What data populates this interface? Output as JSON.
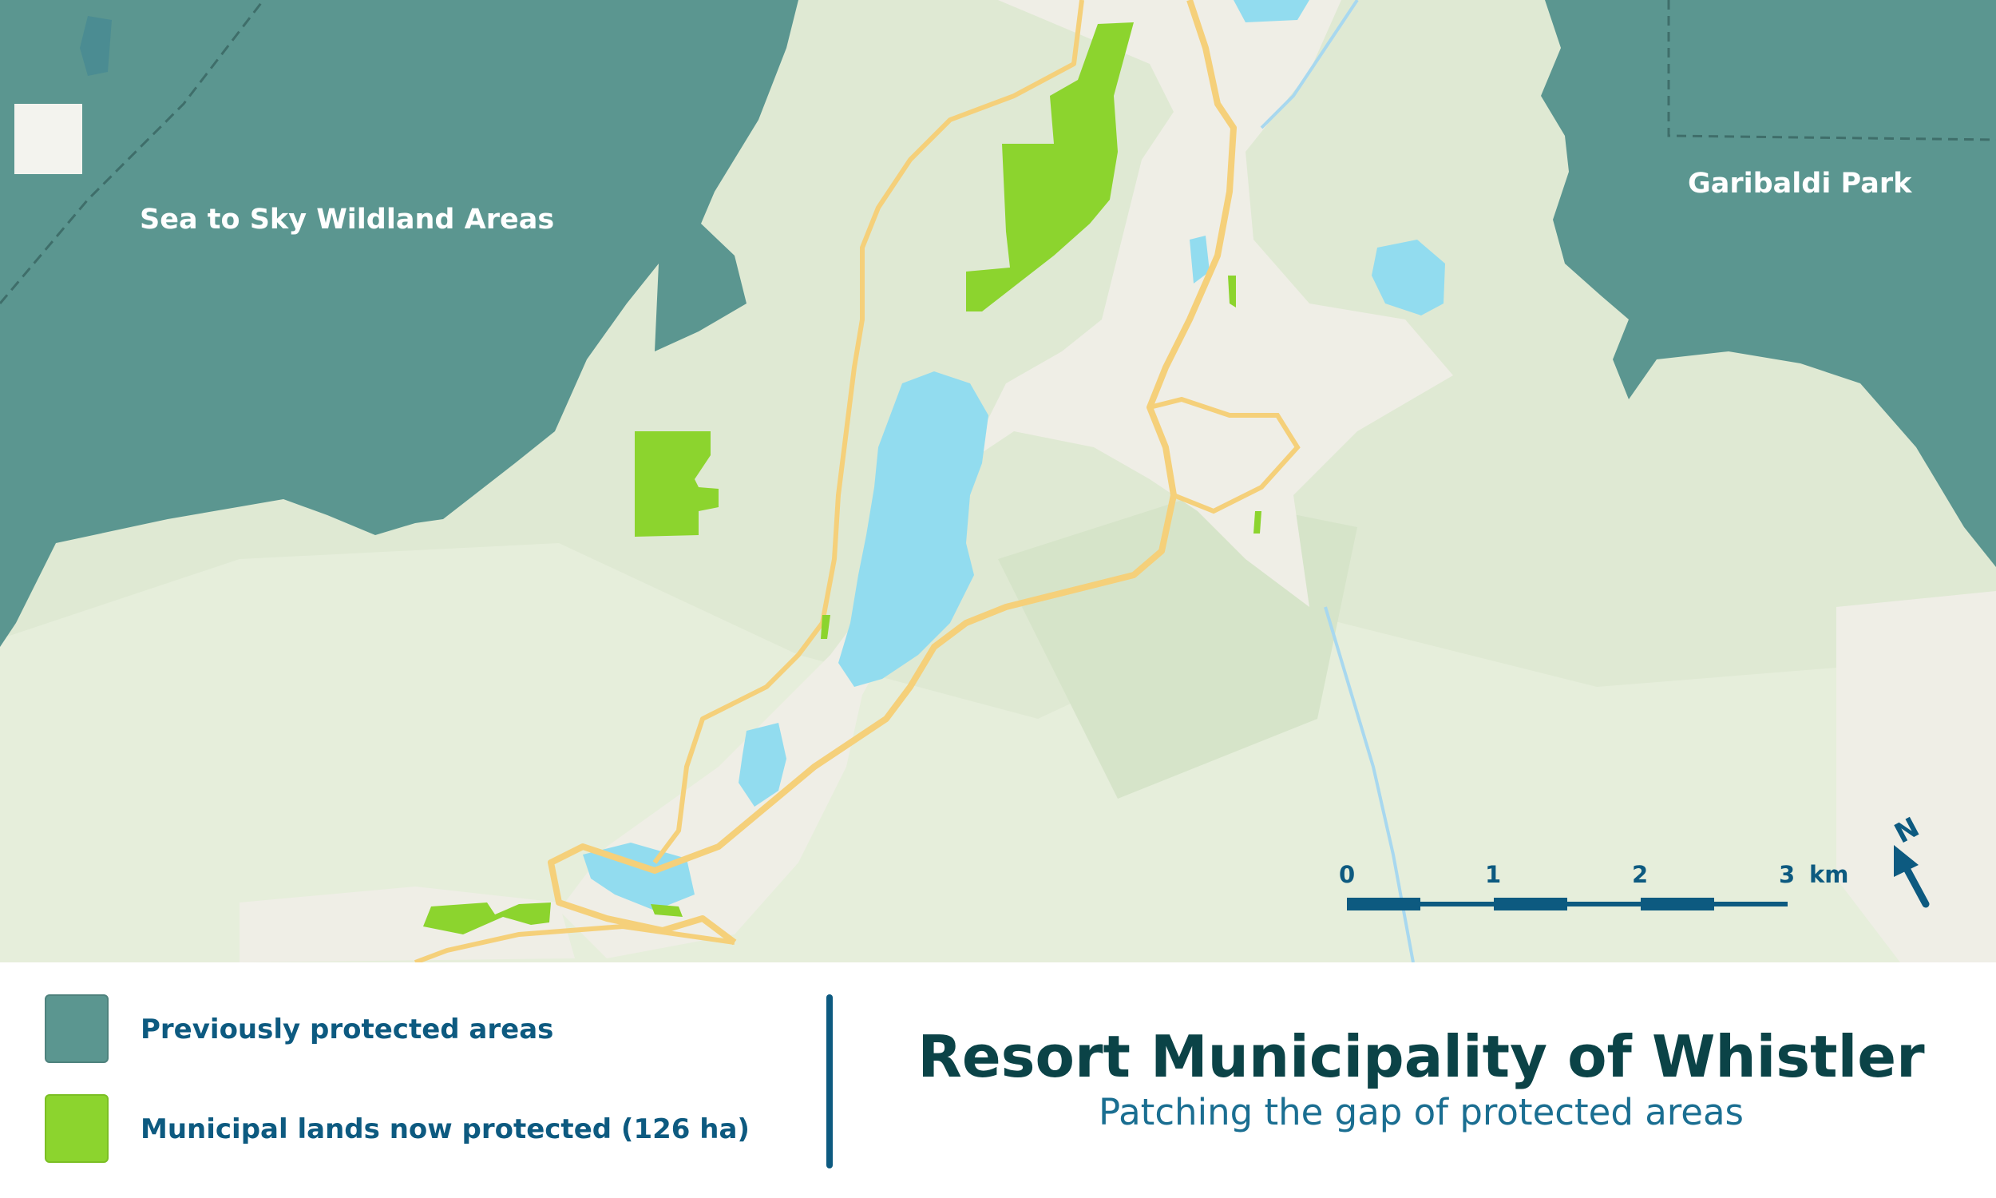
{
  "map": {
    "area_labels": {
      "sea_to_sky": "Sea to Sky Wildland Areas",
      "garibaldi": "Garibaldi Park"
    },
    "scale_bar": {
      "ticks": [
        "0",
        "1",
        "2",
        "3"
      ],
      "unit": "km"
    },
    "north_arrow": "N",
    "colors": {
      "land": "#dfe9d3",
      "previously_protected": "#5b9690",
      "newly_protected": "#8cd42e",
      "water": "#92dcef",
      "roads": "#f5d07a",
      "urban": "#efeee6",
      "accent": "#0d5a80"
    }
  },
  "legend": {
    "items": [
      {
        "label": "Previously protected areas",
        "color": "#5b9690"
      },
      {
        "label": "Municipal lands now protected (126 ha)",
        "color": "#8cd42e"
      }
    ]
  },
  "title": {
    "main": "Resort Municipality of Whistler",
    "subtitle": "Patching the gap of protected areas"
  }
}
